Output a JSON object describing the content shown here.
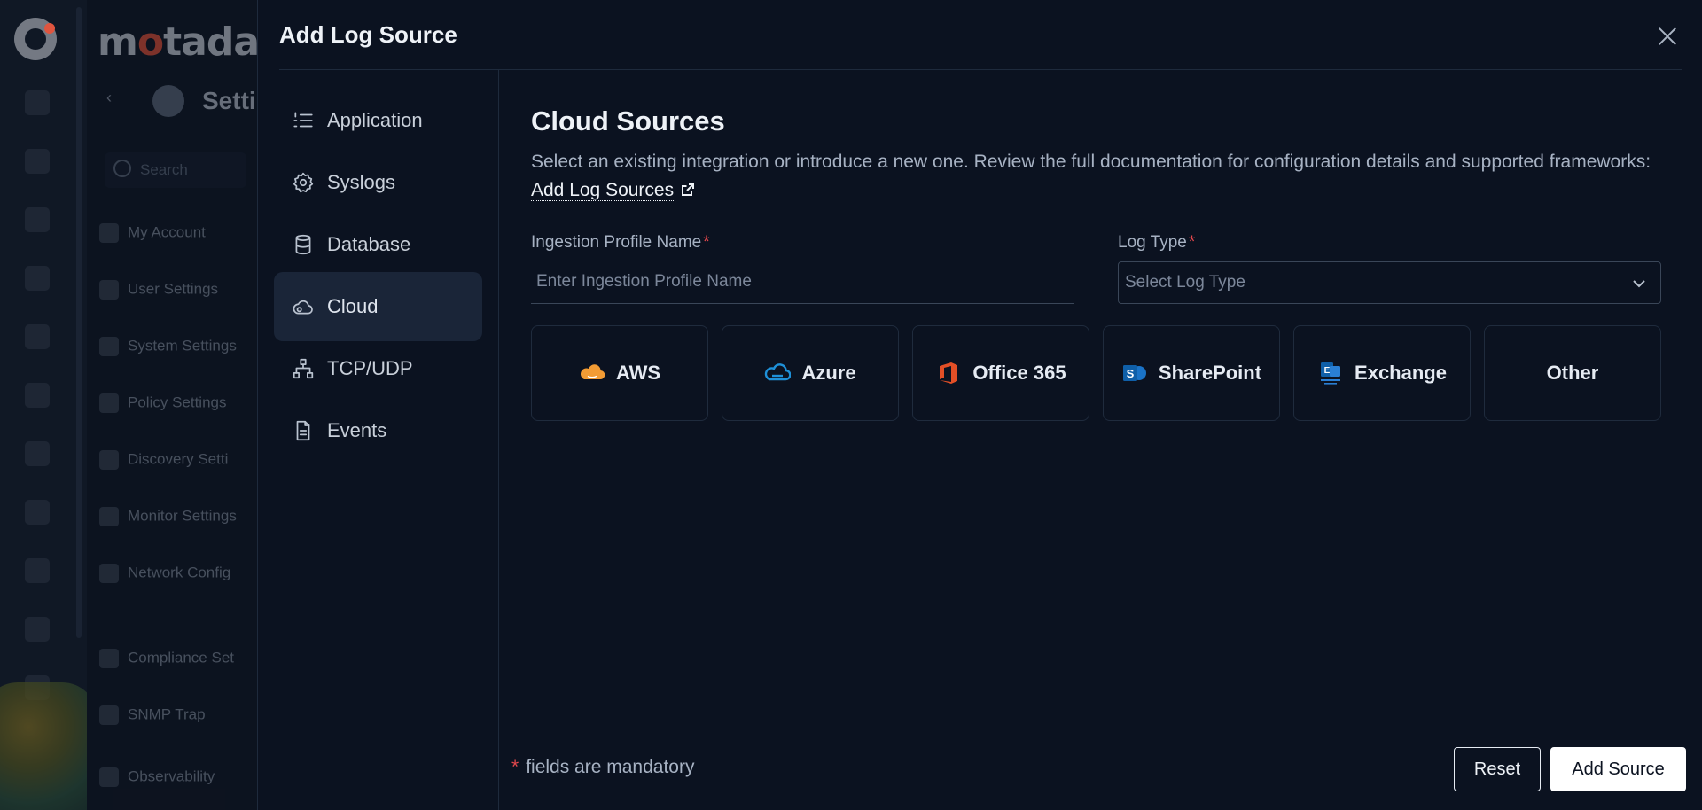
{
  "drawer": {
    "title": "Add Log Source"
  },
  "nav": {
    "items": [
      {
        "label": "Application",
        "icon": "list-icon",
        "active": false
      },
      {
        "label": "Syslogs",
        "icon": "gear-icon",
        "active": false
      },
      {
        "label": "Database",
        "icon": "database-icon",
        "active": false
      },
      {
        "label": "Cloud",
        "icon": "cloud-icon",
        "active": true
      },
      {
        "label": "TCP/UDP",
        "icon": "network-icon",
        "active": false
      },
      {
        "label": "Events",
        "icon": "document-icon",
        "active": false
      }
    ]
  },
  "main": {
    "title": "Cloud Sources",
    "description": "Select an existing integration or introduce a new one. Review the full documentation for configuration details and supported frameworks:",
    "doc_link": "Add Log Sources",
    "profile_label": "Ingestion Profile Name",
    "profile_placeholder": "Enter Ingestion Profile Name",
    "logtype_label": "Log Type",
    "logtype_placeholder": "Select Log Type",
    "required_mark": "*"
  },
  "sources": [
    {
      "label": "AWS",
      "icon": "aws-icon"
    },
    {
      "label": "Azure",
      "icon": "azure-icon"
    },
    {
      "label": "Office 365",
      "icon": "office365-icon"
    },
    {
      "label": "SharePoint",
      "icon": "sharepoint-icon"
    },
    {
      "label": "Exchange",
      "icon": "exchange-icon"
    },
    {
      "label": "Other",
      "icon": ""
    }
  ],
  "footer": {
    "mandatory_note": "fields are mandatory",
    "reset_label": "Reset",
    "add_label": "Add Source"
  },
  "colors": {
    "background": "#0b1220",
    "active_nav": "#1a2538",
    "required": "#e5484d",
    "aws": "#f39c34",
    "azure": "#1e90d8",
    "office365": "#e34f26",
    "sharepoint": "#1a73c7"
  }
}
